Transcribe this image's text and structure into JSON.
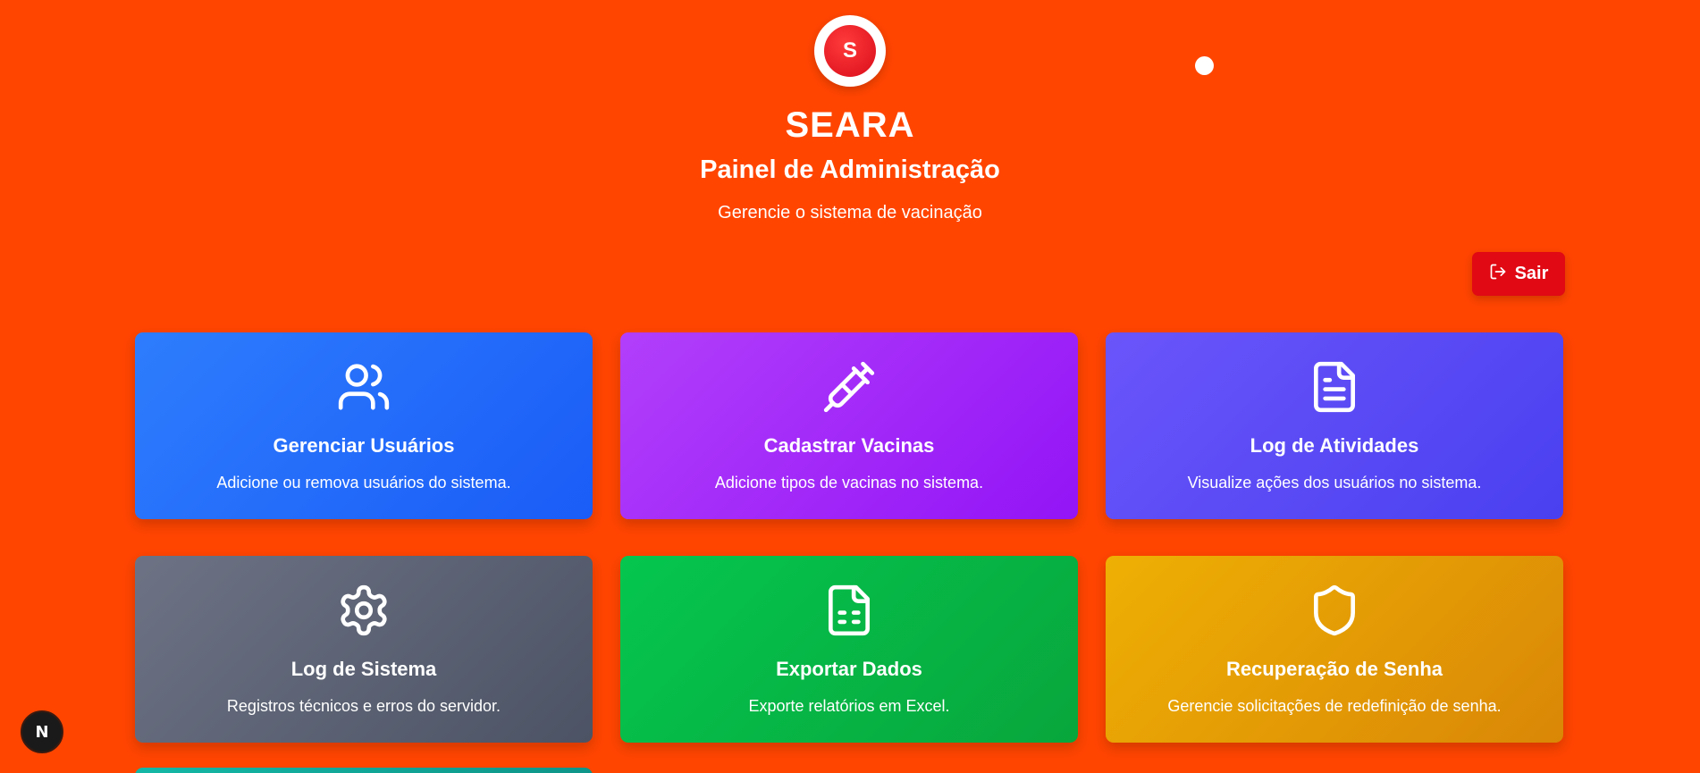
{
  "header": {
    "logo_letter": "S",
    "brand": "SEARA",
    "title": "Painel de Administração",
    "subtitle": "Gerencie o sistema de vacinação"
  },
  "logout": {
    "label": "Sair",
    "icon": "logout-icon",
    "color": "#e00914"
  },
  "background_color": "#ff4500",
  "cards": [
    {
      "title": "Gerenciar Usuários",
      "description": "Adicione ou remova usuários do sistema.",
      "icon": "users-icon",
      "color": "#2e7dfd"
    },
    {
      "title": "Cadastrar Vacinas",
      "description": "Adicione tipos de vacinas no sistema.",
      "icon": "syringe-icon",
      "color": "#b23ffb"
    },
    {
      "title": "Log de Atividades",
      "description": "Visualize ações dos usuários no sistema.",
      "icon": "file-text-icon",
      "color": "#6a55fa"
    },
    {
      "title": "Log de Sistema",
      "description": "Registros técnicos e erros do servidor.",
      "icon": "gear-icon",
      "color": "#6d7384"
    },
    {
      "title": "Exportar Dados",
      "description": "Exporte relatórios em Excel.",
      "icon": "spreadsheet-icon",
      "color": "#05c64f"
    },
    {
      "title": "Recuperação de Senha",
      "description": "Gerencie solicitações de redefinição de senha.",
      "icon": "shield-icon",
      "color": "#efb004"
    }
  ],
  "dev_badge": {
    "label": "N"
  }
}
